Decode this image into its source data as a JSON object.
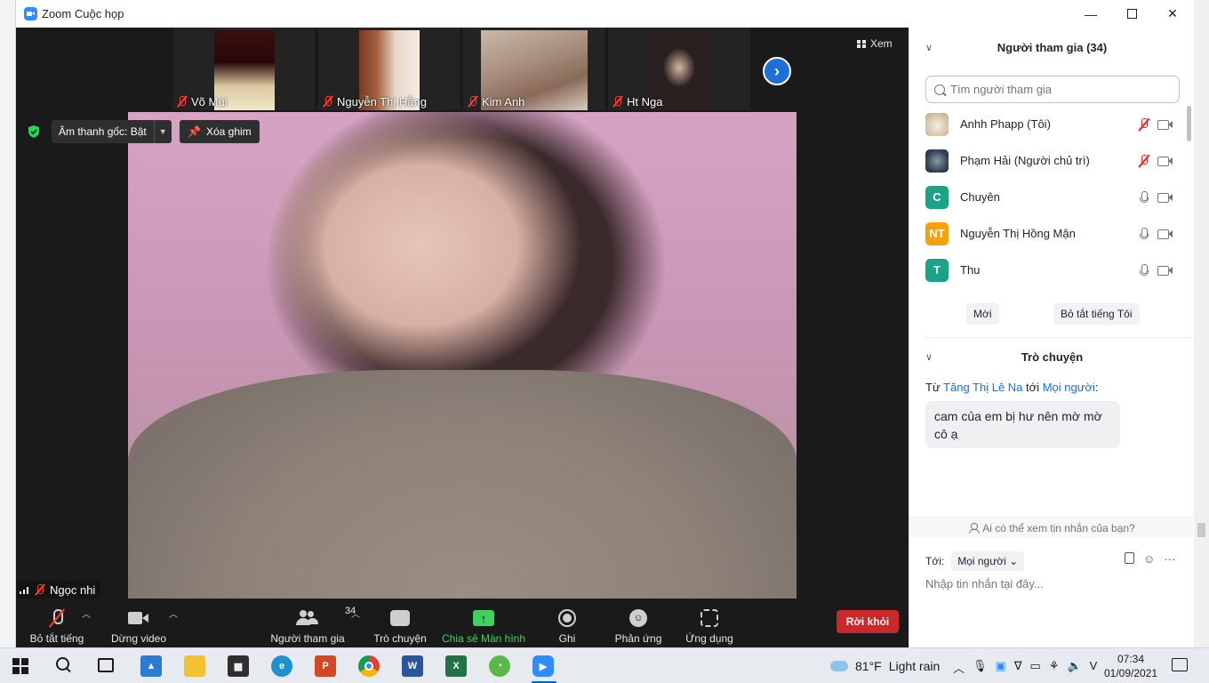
{
  "window": {
    "title": "Zoom Cuộc họp",
    "minimize_icon": "minimize-icon",
    "maximize_icon": "maximize-icon",
    "close_icon": "close-icon"
  },
  "gallery": {
    "thumbnails": [
      {
        "name": "Võ Mùi",
        "muted": true
      },
      {
        "name": "Nguyễn Thị Hằng",
        "muted": true
      },
      {
        "name": "Kim Anh",
        "muted": true
      },
      {
        "name": "Ht Nga",
        "muted": true
      }
    ],
    "view_label": "Xem",
    "next_icon": "chevron-right-icon"
  },
  "controls": {
    "original_audio": "Âm thanh gốc: Bật",
    "unpin": "Xóa ghim"
  },
  "main_video": {
    "speaker_name": "Ngọc nhi"
  },
  "toolbar": {
    "mute": "Bỏ tắt tiếng",
    "video": "Dừng video",
    "participants": "Người tham gia",
    "participants_count": "34",
    "chat": "Trò chuyện",
    "share": "Chia sẻ Màn hình",
    "record": "Ghi",
    "reactions": "Phản ứng",
    "apps": "Ứng dụng",
    "leave": "Rời khỏi"
  },
  "participants_panel": {
    "title": "Người tham gia (34)",
    "search_placeholder": "Tìm người tham gia",
    "items": [
      {
        "name": "Anhh Phapp (Tôi)",
        "avatar": "",
        "avatar_color": "#d9c7a8",
        "mic": "off"
      },
      {
        "name": "Phạm Hải (Người chủ trì)",
        "avatar": "",
        "avatar_color": "#3a4a5c",
        "mic": "off"
      },
      {
        "name": "Chuyên",
        "avatar": "C",
        "avatar_color": "#1aa386",
        "mic": "on"
      },
      {
        "name": "Nguyễn Thị Hồng Mận",
        "avatar": "NT",
        "avatar_color": "#f5a20a",
        "mic": "on"
      },
      {
        "name": "Thu",
        "avatar": "T",
        "avatar_color": "#1aa386",
        "mic": "on"
      }
    ],
    "invite": "Mời",
    "mute_me": "Bỏ tắt tiếng Tôi"
  },
  "chat_panel": {
    "title": "Trò chuyện",
    "from_prefix": "Từ",
    "from_name": "Tăng Thị Lê Na",
    "to_word": "tới",
    "to_name": "Mọi người",
    "message": "cam của em bị hư nên mờ mờ cô ạ",
    "who_can_see": "Ai có thể xem tin nhắn của bạn?",
    "to_label": "Tới:",
    "to_select": "Mọi người",
    "input_placeholder": "Nhập tin nhắn tại đây..."
  },
  "taskbar": {
    "weather_temp": "81°F",
    "weather_desc": "Light rain",
    "time": "07:34",
    "date": "01/09/2021",
    "apps": [
      {
        "name": "photos-app-icon",
        "color": "#2b7bd3",
        "glyph": "▲"
      },
      {
        "name": "file-explorer-icon",
        "color": "#f2c230",
        "glyph": ""
      },
      {
        "name": "store-icon",
        "color": "#2f2f2f",
        "glyph": "▦"
      },
      {
        "name": "edge-icon",
        "color": "#1e8fcf",
        "glyph": "e"
      },
      {
        "name": "powerpoint-icon",
        "color": "#d24726",
        "glyph": "P"
      },
      {
        "name": "chrome-icon",
        "color": "#e5a823",
        "glyph": "◉"
      },
      {
        "name": "word-icon",
        "color": "#2b579a",
        "glyph": "W"
      },
      {
        "name": "excel-icon",
        "color": "#217346",
        "glyph": "X"
      },
      {
        "name": "coccoc-icon",
        "color": "#5ab84b",
        "glyph": "◔"
      },
      {
        "name": "zoom-app-icon",
        "color": "#2d8cff",
        "glyph": "▶"
      }
    ]
  }
}
